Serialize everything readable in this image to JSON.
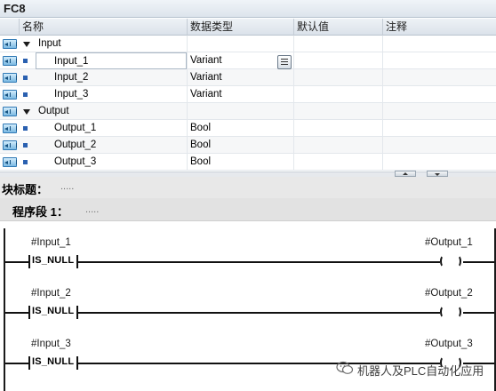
{
  "block": {
    "title": "FC8"
  },
  "interface": {
    "columns": [
      "名称",
      "数据类型",
      "默认值",
      "注释"
    ],
    "rows": [
      {
        "name": "Input",
        "type": "",
        "kind": "section"
      },
      {
        "name": "Input_1",
        "type": "Variant",
        "kind": "param",
        "editing": true
      },
      {
        "name": "Input_2",
        "type": "Variant",
        "kind": "param"
      },
      {
        "name": "Input_3",
        "type": "Variant",
        "kind": "param"
      },
      {
        "name": "Output",
        "type": "",
        "kind": "section"
      },
      {
        "name": "Output_1",
        "type": "Bool",
        "kind": "param"
      },
      {
        "name": "Output_2",
        "type": "Bool",
        "kind": "param"
      },
      {
        "name": "Output_3",
        "type": "Bool",
        "kind": "param"
      }
    ]
  },
  "block_title": {
    "label": "块标题：",
    "placeholder": "....."
  },
  "network": {
    "label": "程序段 1：",
    "placeholder": ".....",
    "rungs": [
      {
        "operand": "#Input_1",
        "instruction": "IS_NULL",
        "coil_operand": "#Output_1"
      },
      {
        "operand": "#Input_2",
        "instruction": "IS_NULL",
        "coil_operand": "#Output_2"
      },
      {
        "operand": "#Input_3",
        "instruction": "IS_NULL",
        "coil_operand": "#Output_3"
      }
    ]
  },
  "watermark": {
    "text": "机器人及PLC自动化应用",
    "icon": "wechat-icon"
  },
  "colors": {
    "icon_blue": "#2f79b5",
    "header_bg": "#dde4ec"
  }
}
